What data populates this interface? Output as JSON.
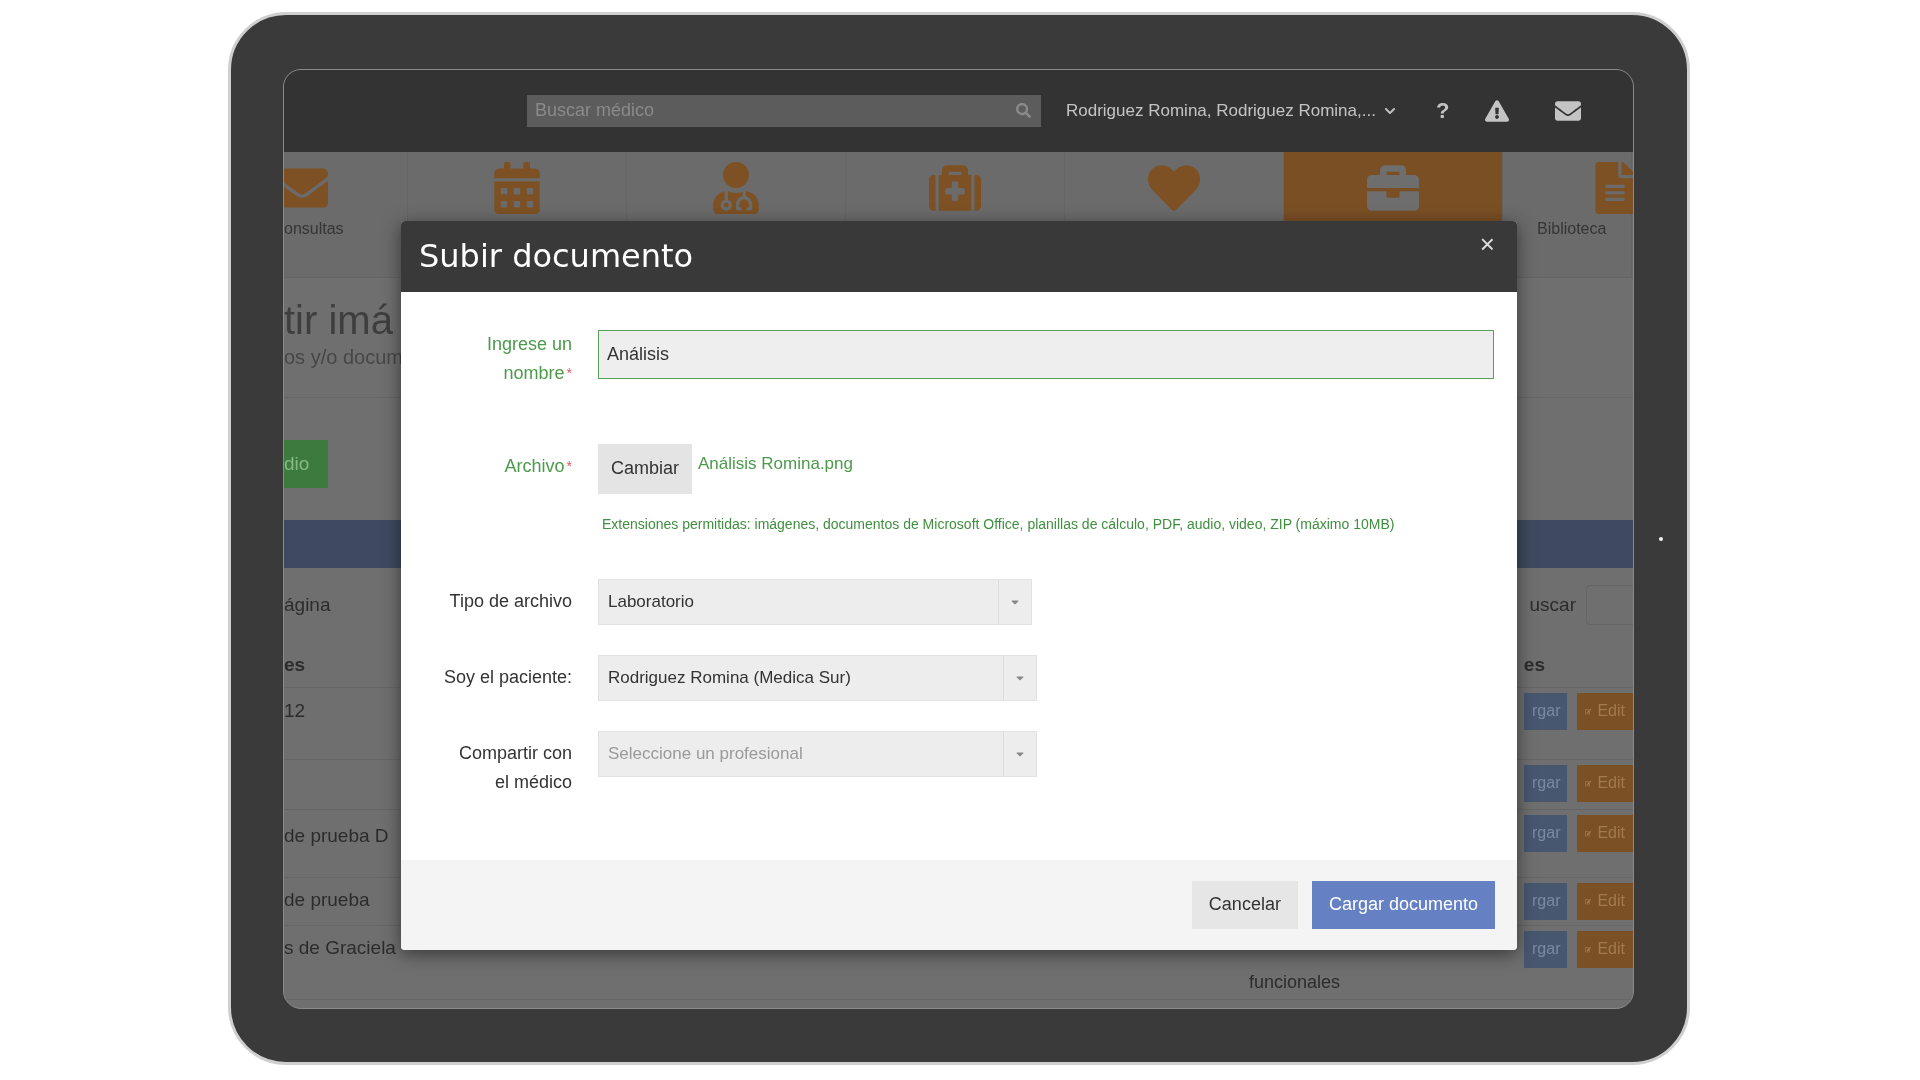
{
  "topbar": {
    "search_placeholder": "Buscar médico",
    "user": "Rodriguez Romina, Rodriguez Romina,...",
    "help": "?"
  },
  "nav": [
    {
      "label": "onsultas",
      "selected": false
    },
    {
      "selected": false
    },
    {
      "selected": false
    },
    {
      "selected": false
    },
    {
      "selected": false
    },
    {
      "selected": true
    },
    {
      "label": "Biblioteca",
      "selected": false
    }
  ],
  "page": {
    "title": "tir imá",
    "subtitle": "os y/o docum",
    "button": "dio",
    "pager_label": "ágina",
    "search_label": "uscar",
    "columns": [
      "es",
      "es"
    ],
    "rows": [
      {
        "cell": "12",
        "actions": [
          "rgar",
          "Edit"
        ]
      },
      {
        "actions": [
          "rgar",
          "Edit"
        ]
      },
      {
        "cell": "de prueba D",
        "actions": [
          "rgar",
          "Edit"
        ]
      },
      {
        "cell": "de prueba",
        "actions": [
          "rgar",
          "Edit"
        ]
      },
      {
        "cell": "s de Graciela",
        "note": "funcionales",
        "actions": [
          "rgar",
          "Edit"
        ]
      }
    ]
  },
  "modal": {
    "title": "Subir documento",
    "close": "×",
    "fields": [
      {
        "kind": "text",
        "label": "Ingrese un nombre",
        "required_mark": "*",
        "valid": true,
        "value": "Análisis"
      },
      {
        "kind": "file",
        "label": "Archivo",
        "required_mark": "*",
        "valid": true,
        "button": "Cambiar",
        "filename": "Análisis Romina.png",
        "help": "Extensiones permitidas: imágenes, documentos de Microsoft Office, planillas de cálculo, PDF, audio, video, ZIP (máximo 10MB)"
      },
      {
        "kind": "select",
        "label": "Tipo de archivo",
        "valid": false,
        "value": "Laboratorio"
      },
      {
        "kind": "select",
        "label": "Soy el paciente:",
        "valid": false,
        "value": "Rodriguez Romina (Medica Sur)"
      },
      {
        "kind": "select",
        "label": "Compartir con el médico",
        "valid": false,
        "placeholder": "Seleccione un profesional"
      }
    ],
    "buttons": [
      {
        "kind": "secondary",
        "label": "Cancelar"
      },
      {
        "kind": "primary",
        "label": "Cargar documento"
      }
    ]
  }
}
